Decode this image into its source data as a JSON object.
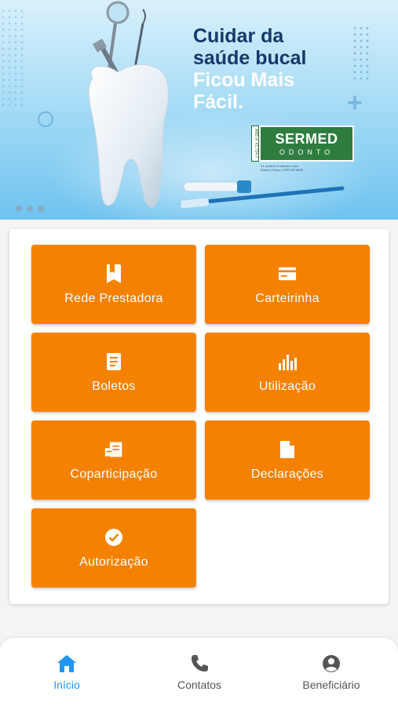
{
  "banner": {
    "headline_line1": "Cuidar da",
    "headline_line2": "saúde bucal",
    "headline_line3": "Ficou Mais",
    "headline_line4": "Fácil.",
    "logo_name": "SERMED",
    "logo_sub": "ODONTO",
    "logo_ans": "ANS nº 41.724-7",
    "logo_caption_line1": "Dr. Antônio Colturato Lucia",
    "logo_caption_line2": "Diretor Clínico | CRO-SP 8585",
    "pager_count": 3
  },
  "menu": {
    "items": [
      {
        "label": "Rede Prestadora",
        "icon": "bookmark-book-icon"
      },
      {
        "label": "Carteirinha",
        "icon": "card-icon"
      },
      {
        "label": "Boletos",
        "icon": "document-icon"
      },
      {
        "label": "Utilização",
        "icon": "bar-chart-icon"
      },
      {
        "label": "Coparticipação",
        "icon": "receipt-icon"
      },
      {
        "label": "Declarações",
        "icon": "file-icon"
      },
      {
        "label": "Autorização",
        "icon": "check-circle-icon"
      }
    ],
    "tile_color": "#f58100"
  },
  "bottom_nav": {
    "items": [
      {
        "label": "Início",
        "icon": "home-icon",
        "active": true
      },
      {
        "label": "Contatos",
        "icon": "phone-icon",
        "active": false
      },
      {
        "label": "Beneficiário",
        "icon": "account-circle-icon",
        "active": false
      }
    ],
    "active_color": "#2196f3"
  }
}
